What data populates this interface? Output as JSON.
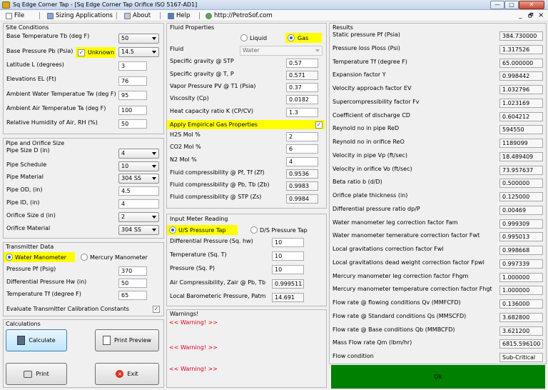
{
  "window": {
    "title": "Sq Edge Corner Tap - [Sq Edge Corner Tap Orifice ISO 5167-AD1]",
    "minimize": "—",
    "maximize": "□",
    "close": "✕"
  },
  "menu": {
    "file": "File",
    "sizing": "Sizing Applications",
    "about": "About",
    "help": "Help",
    "url": "http://PetroSof.com",
    "min": "_",
    "restore": "🗗",
    "close": "×"
  },
  "site": {
    "title": "Site Conditions",
    "base_temp_label": "Base Temperature Tb (deg F)",
    "base_temp": "50",
    "base_press_label": "Base Pressure Pb (Psia)",
    "unknown": "Unknown",
    "base_press": "14.5",
    "lat_label": "Latitude L (degrees)",
    "lat": "3",
    "elev_label": "Elevations EL (Ft)",
    "elev": "76",
    "water_temp_label": "Ambient Water Temperatue Tw (deg F)",
    "water_temp": "95",
    "air_temp_label": "Ambient Air Temperatue Ta (deg F)",
    "air_temp": "100",
    "humid_label": "Relative Humidity of Air, RH (%)",
    "humid": "50"
  },
  "pipe": {
    "title": "Pipe and Orifice Size",
    "size_label": "Pipe Size D (in)",
    "size": "4",
    "sched_label": "Pipe Schedule",
    "sched": "10",
    "mat_label": "Pipe Material",
    "mat": "304 SS",
    "od_label": "Pipe OD, (in)",
    "od": "4.5",
    "id_label": "Pipe ID, (in)",
    "id": "4",
    "orif_label": "Orifice Size d (in)",
    "orif": "2",
    "orif_mat_label": "Orifice Material",
    "orif_mat": "304 SS"
  },
  "trans": {
    "title": "Transmitter Data",
    "water": "Water Manometer",
    "mercury": "Mercury Manometer",
    "pf_label": "Pressure Pf (Psig)",
    "pf": "370",
    "hw_label": "Differential Pressure Hw (in)",
    "hw": "50",
    "tf_label": "Temperature Tf (degree F)",
    "tf": "65",
    "eval_label": "Evaluate Transmitter Calibration Constants"
  },
  "calc": {
    "title": "Calculations",
    "calculate": "Calculate",
    "print_preview": "Print Preview",
    "print": "Print",
    "exit": "Exit"
  },
  "fluid": {
    "title": "Fluid Properties",
    "liquid": "Liquid",
    "gas": "Gas",
    "fluid_label": "Fluid",
    "fluid": "Water",
    "sg_std_label": "Specific gravity @ STP",
    "sg_std": "0.57",
    "sg_tp_label": "Specific gravity @ T, P",
    "sg_tp": "0.571",
    "pv_label": "Vapor Pressure PV @ T1 (Psia)",
    "pv": "0.37",
    "visc_label": "Viscosity (Cp)",
    "visc": "0.0182",
    "k_label": "Heat capacity ratio K (CP/CV)",
    "k": "1.3",
    "emp_label": "Apply Empirical Gas Properties",
    "h2s_label": "H2S Mol %",
    "h2s": "2",
    "co2_label": "CO2 Mol %",
    "co2": "6",
    "n2_label": "N2 Mol %",
    "n2": "4",
    "zf_label": "Fluid compressibility @ Pf, Tf (Zf)",
    "zf": "0.9536",
    "zb_label": "Fluid compressibility @ Pb, Tb (Zb)",
    "zb": "0.9983",
    "zs_label": "Fluid compressibility @ STP (Zs)",
    "zs": "0.9984"
  },
  "meter": {
    "title": "Input Meter Reading",
    "us": "U/S Pressure Tap",
    "ds": "D/S Pressure Tap",
    "dp_label": "Differential Pressure (Sq. hw)",
    "dp": "10",
    "t_label": "Temperature (Sq. T)",
    "t": "10",
    "p_label": "Pressure (Sq. P)",
    "p": "10",
    "zair_label": "Air Compressibility, Zair @ Pb, Tb",
    "zair": "0.999511",
    "patm_label": "Local Barometeric Pressure, Patm",
    "patm": "14.691"
  },
  "warnings": {
    "title": "Warnings!",
    "w1": "<< Warning! >>",
    "w2": "<< Warning! >>",
    "w3": "<< Warning! >>"
  },
  "results": {
    "title": "Results",
    "ok": "Ok",
    "items": [
      {
        "label": "Static pressure Pf (Psia)",
        "value": "384.730000"
      },
      {
        "label": "Pressure loss Ploss (Psi)",
        "value": "1.317526"
      },
      {
        "label": "Temperature Tf (degree F)",
        "value": "65.000000"
      },
      {
        "label": "Expansion factor Y",
        "value": "0.998442"
      },
      {
        "label": "Velocity approach factor EV",
        "value": "1.032796"
      },
      {
        "label": "Supercompressibility factor Fv",
        "value": "1.023169"
      },
      {
        "label": "Coefficient of discharge CD",
        "value": "0.604212"
      },
      {
        "label": "Reynold no in pipe ReD",
        "value": "594550"
      },
      {
        "label": "Reynold no in orifice ReO",
        "value": "1189099"
      },
      {
        "label": "Velocity in pipe Vp (ft/sec)",
        "value": "18.489409"
      },
      {
        "label": "Velocity in orifice Vo (ft/sec)",
        "value": "73.957637"
      },
      {
        "label": "Beta ratio b (d/D)",
        "value": "0.500000"
      },
      {
        "label": "Orifice plate thickness (in)",
        "value": "0.125000"
      },
      {
        "label": "Differential pressure ratio dp/P",
        "value": "0.00469"
      },
      {
        "label": "Water manometer leg correction factor Fam",
        "value": "0.999309"
      },
      {
        "label": "Water manometer temerature correction factor Fwt",
        "value": "0.995013"
      },
      {
        "label": "Local gravitations correction factor Fwl",
        "value": "0.998668"
      },
      {
        "label": "Local gravitations dead weight correction factor Fpwl",
        "value": "0.997339"
      },
      {
        "label": "Mercury manometer leg correction factor Fhgm",
        "value": "1.000000"
      },
      {
        "label": "Mercury manometer temperature correction factor Fhgt",
        "value": "1.000000"
      },
      {
        "label": "Flow rate @ flowing conditions Qv (MMFCFD)",
        "value": "0.136000"
      },
      {
        "label": "Flow rate @ Standard conditions Qs (MMSCFD)",
        "value": "3.682800"
      },
      {
        "label": "Flow rate @ Base conditions Qb (MMBCFD)",
        "value": "3.621200"
      },
      {
        "label": "Mass Flow rate Qm (lbm/hr)",
        "value": "6815.596100"
      },
      {
        "label": "Flow condition",
        "value": "Sub-Critical"
      }
    ]
  }
}
